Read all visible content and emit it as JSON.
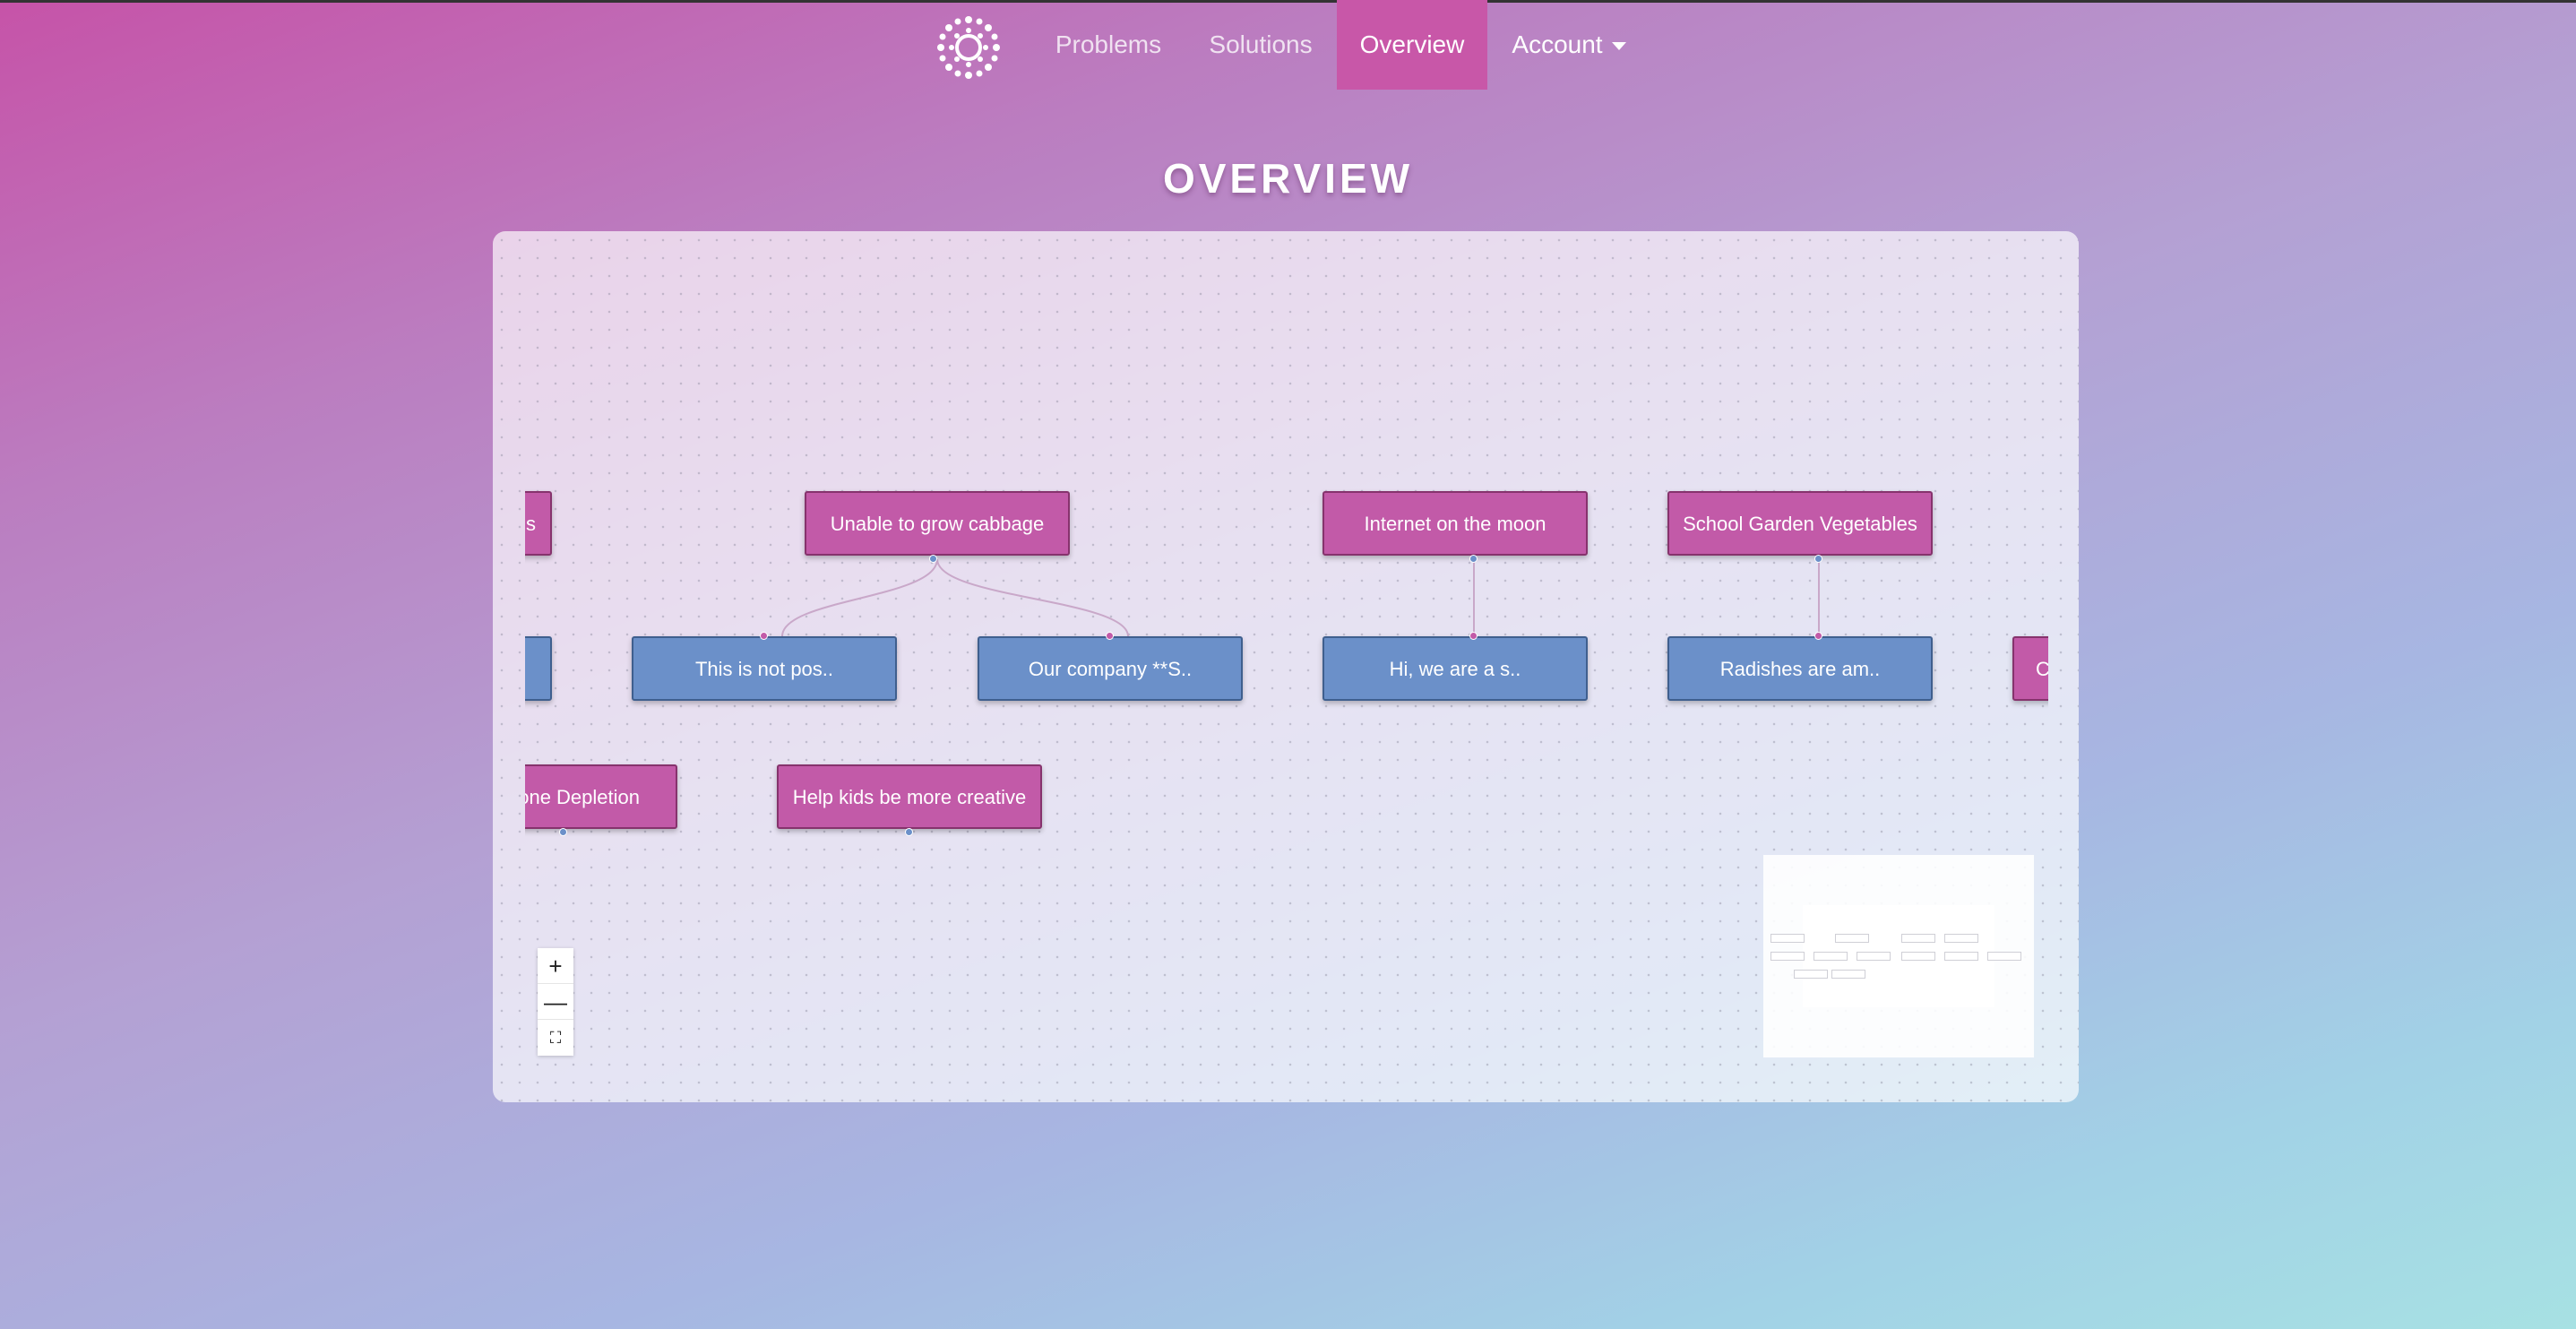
{
  "nav": {
    "logo": "sunburst-logo",
    "items": [
      {
        "label": "Problems"
      },
      {
        "label": "Solutions"
      },
      {
        "label": "Overview",
        "active": true
      },
      {
        "label": "Account",
        "has_dropdown": true
      }
    ]
  },
  "page": {
    "title": "OVERVIEW"
  },
  "flow": {
    "problems": [
      "s",
      "Unable to grow cabbage",
      "Internet on the moon",
      "School Garden Vegetables",
      "Ozone Depletion",
      "Help kids be more creative",
      "C"
    ],
    "solutions": [
      "This is not pos..",
      "Our company **S..",
      "Hi, we are a s..",
      "Radishes are am.."
    ]
  },
  "controls": {
    "zoom_in": "+",
    "zoom_out": "—",
    "fit": "⛶"
  },
  "colors": {
    "problem": "#c25aa8",
    "solution": "#6b90c9",
    "active_nav": "#c857a8"
  }
}
